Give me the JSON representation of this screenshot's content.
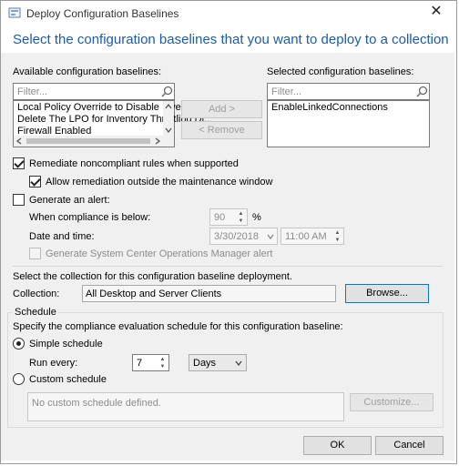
{
  "window": {
    "title": "Deploy Configuration Baselines",
    "close_glyph": "✕",
    "app_icon": "configuration-icon"
  },
  "header": "Select the configuration baselines that you want to deploy to a collection",
  "available": {
    "label": "Available configuration baselines:",
    "filter_placeholder": "Filter...",
    "items": [
      "Local Policy Override to Disable Inventory ...",
      "Delete The LPO for Inventory Throttling Di...",
      "Firewall Enabled"
    ]
  },
  "selected": {
    "label": "Selected configuration baselines:",
    "filter_placeholder": "Filter...",
    "items": [
      "EnableLinkedConnections"
    ]
  },
  "buttons": {
    "add": "Add >",
    "remove": "< Remove",
    "browse": "Browse...",
    "customize": "Customize...",
    "ok": "OK",
    "cancel": "Cancel"
  },
  "remediate": {
    "label": "Remediate noncompliant rules when supported",
    "checked": true
  },
  "allow_remediation": {
    "label": "Allow remediation outside the maintenance window",
    "checked": true
  },
  "alert": {
    "label": "Generate an alert:",
    "checked": false,
    "compliance_label": "When compliance is below:",
    "compliance_value": "90",
    "percent": "%",
    "date_label": "Date and time:",
    "date": "3/30/2018",
    "time": "11:00 AM",
    "scom_label": "Generate System Center Operations Manager alert"
  },
  "collection": {
    "instruction": "Select the collection for this configuration baseline deployment.",
    "label": "Collection:",
    "value": "All Desktop and Server Clients"
  },
  "schedule": {
    "group_label": "Schedule",
    "instruction": "Specify the compliance evaluation schedule for this configuration baseline:",
    "simple_label": "Simple schedule",
    "run_every_label": "Run every:",
    "run_every_value": "7",
    "unit": "Days",
    "custom_label": "Custom schedule",
    "custom_text": "No custom schedule defined."
  }
}
